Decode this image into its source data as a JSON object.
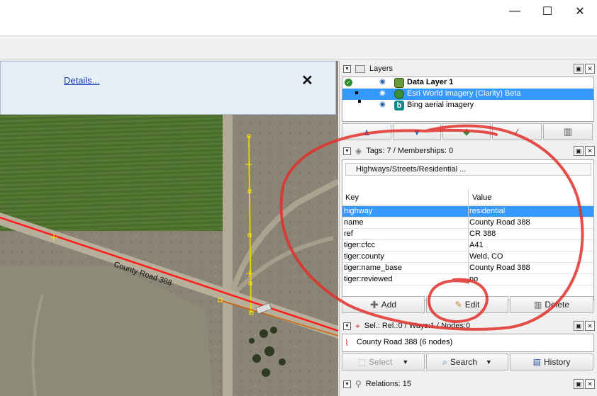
{
  "window": {
    "controls": {
      "minimize": "—",
      "maximize": "☐",
      "close": "✕"
    }
  },
  "notice": {
    "link": "Details...",
    "close": "✕"
  },
  "map": {
    "road_label": "County Road 388",
    "field_color": "#4f6f2e",
    "highlight_color": "#ff1a1a",
    "selected_way_color": "#e6d200"
  },
  "layers_panel": {
    "title": "Layers",
    "items": [
      {
        "name": "Data Layer 1",
        "icon": "data-layer-icon",
        "bold": true,
        "selected": false
      },
      {
        "name": "Esri World Imagery (Clarity) Beta",
        "icon": "globe-icon",
        "bold": false,
        "selected": true
      },
      {
        "name": "Bing aerial imagery",
        "icon": "bing-icon",
        "bold": false,
        "selected": false
      }
    ],
    "buttons": [
      "move-up-icon",
      "move-down-icon",
      "merge-icon",
      "toggle-icon",
      "trash-icon"
    ]
  },
  "tags_panel": {
    "title": "Tags: 7 / Memberships: 0",
    "preset": "Highways/Streets/Residential ...",
    "columns": {
      "key": "Key",
      "value": "Value"
    },
    "rows": [
      {
        "key": "highway",
        "value": "residential",
        "selected": true
      },
      {
        "key": "name",
        "value": "County Road 388"
      },
      {
        "key": "ref",
        "value": "CR 388"
      },
      {
        "key": "tiger:cfcc",
        "value": "A41"
      },
      {
        "key": "tiger:county",
        "value": "Weld, CO"
      },
      {
        "key": "tiger:name_base",
        "value": "County Road 388"
      },
      {
        "key": "tiger:reviewed",
        "value": "no"
      }
    ],
    "buttons": {
      "add": "Add",
      "edit": "Edit",
      "delete": "Delete"
    }
  },
  "selection_panel": {
    "title": "Sel.: Rel.:0 / Ways:1 / Nodes:0",
    "item": "County Road 388 (6 nodes)",
    "buttons": {
      "select": "Select",
      "search": "Search",
      "history": "History"
    }
  },
  "relations_panel": {
    "title": "Relations: 15"
  }
}
